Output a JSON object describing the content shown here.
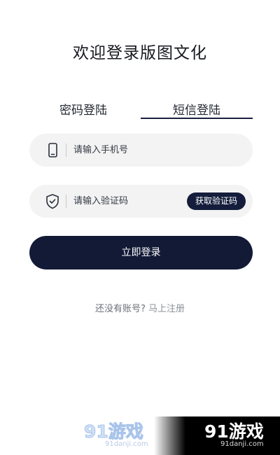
{
  "header": {
    "title": "欢迎登录版图文化"
  },
  "tabs": {
    "password_label": "密码登陆",
    "sms_label": "短信登陆",
    "active": "sms"
  },
  "form": {
    "phone_placeholder": "请输入手机号",
    "code_placeholder": "请输入验证码",
    "get_code_label": "获取验证码",
    "submit_label": "立即登录"
  },
  "register": {
    "prompt": "还没有账号?",
    "link": "马上注册"
  },
  "watermark": {
    "brand_text": "91游戏",
    "site_text": "91danji.com"
  },
  "colors": {
    "accent": "#131a36",
    "field_bg": "#f3f3f3",
    "text": "#1a1f2e"
  }
}
